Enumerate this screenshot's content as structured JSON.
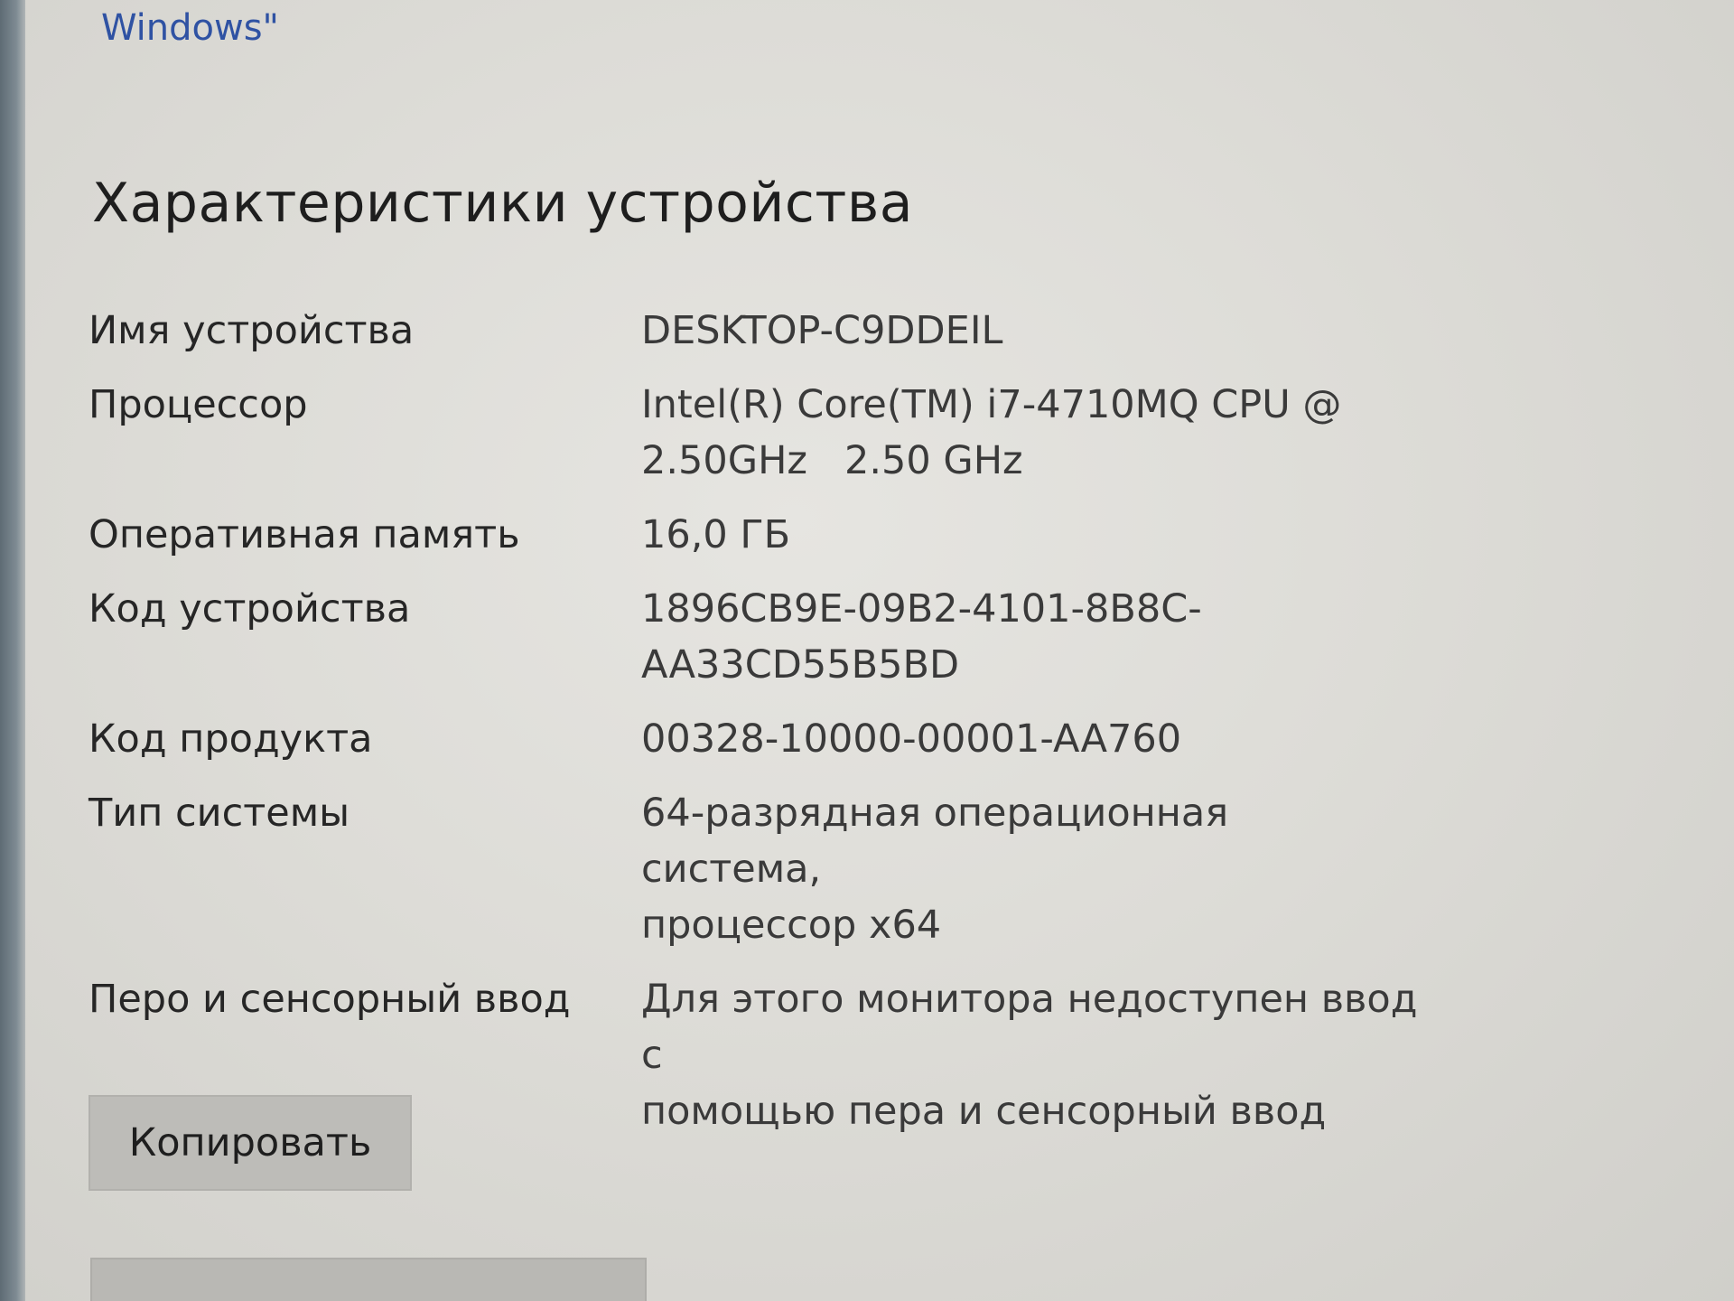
{
  "top_link": {
    "text": "Windows\""
  },
  "section": {
    "title": "Характеристики устройства"
  },
  "specs": [
    {
      "label": "Имя устройства",
      "lines": [
        "DESKTOP-C9DDEIL"
      ]
    },
    {
      "label": "Процессор",
      "lines": [
        "Intel(R) Core(TM) i7-4710MQ CPU @",
        "2.50GHz   2.50 GHz"
      ]
    },
    {
      "label": "Оперативная память",
      "lines": [
        "16,0 ГБ"
      ]
    },
    {
      "label": "Код устройства",
      "lines": [
        "1896CB9E-09B2-4101-8B8C-",
        "AA33CD55B5BD"
      ]
    },
    {
      "label": "Код продукта",
      "lines": [
        "00328-10000-00001-AA760"
      ]
    },
    {
      "label": "Тип системы",
      "lines": [
        "64-разрядная операционная система,",
        "процессор x64"
      ]
    },
    {
      "label": "Перо и сенсорный ввод",
      "lines": [
        "Для этого монитора недоступен ввод с",
        "помощью пера и сенсорный ввод"
      ]
    }
  ],
  "buttons": {
    "copy_label": "Копировать"
  }
}
